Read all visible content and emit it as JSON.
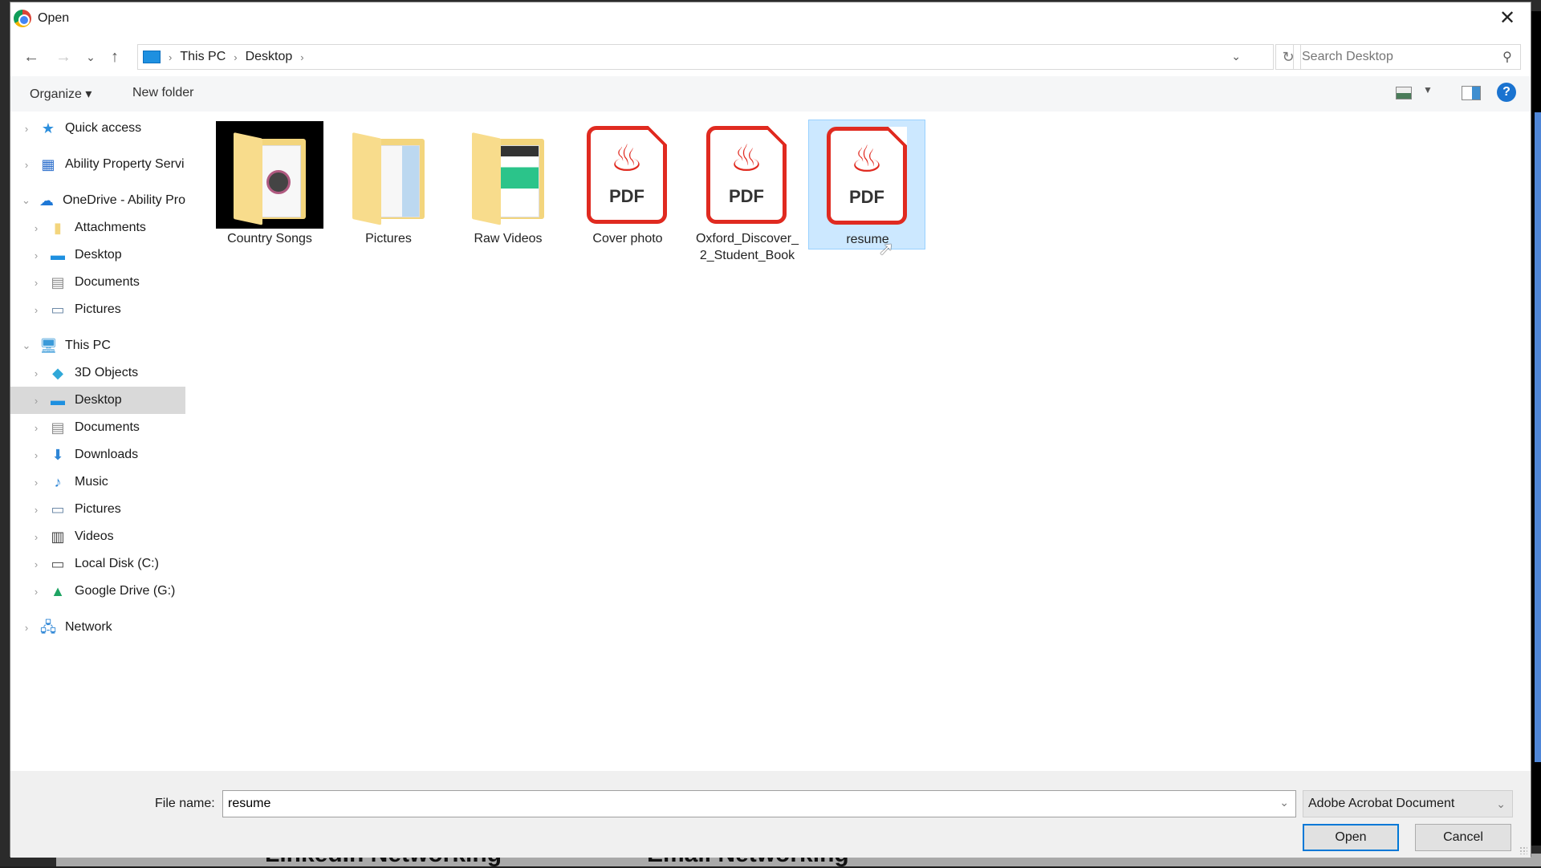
{
  "window": {
    "title": "Open",
    "close_label": "✕"
  },
  "navigation": {
    "back": "←",
    "forward": "→",
    "recent": "⌄",
    "up": "↑",
    "breadcrumbs": [
      "This PC",
      "Desktop"
    ],
    "search_placeholder": "Search Desktop"
  },
  "toolbar": {
    "organize_label": "Organize ▾",
    "new_folder_label": "New folder",
    "help_label": "?"
  },
  "sidebar": {
    "items": [
      {
        "label": "Quick access",
        "icon": "★",
        "color": "#2d8fdd",
        "expanded": false
      },
      {
        "label": "Ability Property Servi",
        "icon": "▦",
        "color": "#2d6fcc",
        "expanded": false
      },
      {
        "label": "OneDrive - Ability Pro",
        "icon": "☁",
        "color": "#1e78d6",
        "expanded": true
      },
      {
        "label": "Attachments",
        "icon": "▮",
        "color": "#f3d57d",
        "expanded": false
      },
      {
        "label": "Desktop",
        "icon": "▬",
        "color": "#1e90e0",
        "expanded": false
      },
      {
        "label": "Documents",
        "icon": "▤",
        "color": "#8a8a8a",
        "expanded": false
      },
      {
        "label": "Pictures",
        "icon": "▭",
        "color": "#6d8aa8",
        "expanded": false
      },
      {
        "label": "This PC",
        "icon": "🖥",
        "color": "#3a9ad9",
        "expanded": true
      },
      {
        "label": "3D Objects",
        "icon": "◆",
        "color": "#30a8d8",
        "expanded": false
      },
      {
        "label": "Desktop",
        "icon": "▬",
        "color": "#1e90e0",
        "expanded": false,
        "selected": true
      },
      {
        "label": "Documents",
        "icon": "▤",
        "color": "#8a8a8a",
        "expanded": false
      },
      {
        "label": "Downloads",
        "icon": "⬇",
        "color": "#2e86d6",
        "expanded": false
      },
      {
        "label": "Music",
        "icon": "♪",
        "color": "#2e86d6",
        "expanded": false
      },
      {
        "label": "Pictures",
        "icon": "▭",
        "color": "#6d8aa8",
        "expanded": false
      },
      {
        "label": "Videos",
        "icon": "▥",
        "color": "#444",
        "expanded": false
      },
      {
        "label": "Local Disk (C:)",
        "icon": "▭",
        "color": "#555",
        "expanded": false
      },
      {
        "label": "Google Drive (G:)",
        "icon": "▲",
        "color": "#1fa463",
        "expanded": false
      },
      {
        "label": "Network",
        "icon": "🖧",
        "color": "#2e86d6",
        "expanded": false
      }
    ]
  },
  "files": [
    {
      "name": "Country Songs",
      "type": "folder-media"
    },
    {
      "name": "Pictures",
      "type": "folder"
    },
    {
      "name": "Raw Videos",
      "type": "folder-web"
    },
    {
      "name": "Cover photo",
      "type": "pdf"
    },
    {
      "name": "Oxford_Discover_ 2_Student_Book",
      "type": "pdf"
    },
    {
      "name": "resume",
      "type": "pdf",
      "selected": true
    }
  ],
  "pdf_label": "PDF",
  "pdf_logo": "♨",
  "footer": {
    "file_name_label": "File name:",
    "file_name_value": "resume",
    "file_type": "Adobe Acrobat Document",
    "open_label": "Open",
    "cancel_label": "Cancel"
  },
  "background_text": [
    "LinkedIn Networking",
    "Email Networking"
  ]
}
